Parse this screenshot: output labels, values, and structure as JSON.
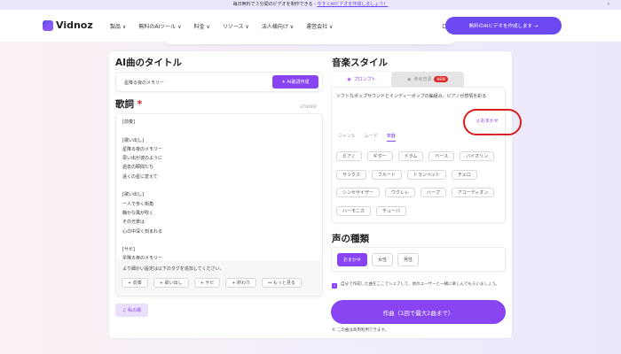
{
  "banner": {
    "text": "毎日無料で３分間のビデオを制作できる - ",
    "link": "今すぐAIビデオを作成しましょう！",
    "close": "×"
  },
  "nav": {
    "brand": "Vidnoz",
    "menu": [
      "製品 ∨",
      "無料のAIツール ∨",
      "料金 ∨",
      "リソース ∨",
      "法人様向け ∨",
      "運営会社 ∨"
    ],
    "login": "ログイン",
    "cta": "無料のAIビデオを作成します →"
  },
  "left": {
    "title_heading": "AI曲のタイトル",
    "title_value": "星降る夜のメモリー",
    "ai_lyrics_button": "✦ AI歌詞作成",
    "lyrics_heading": "歌詞",
    "required": "*",
    "counter": "37/2000",
    "lyrics": "[前奏]\n\n[歌い出し]\n星降る夜のメモリー\n思い出が波のように\n過去の瞬間たち\n遠くの星に変えて\n\n[歌い出し]\n一人で歩く街角\n静かな風が吹く\nその光景は\n心の中深く刻まれる\n\n[サビ]\n星降る夜のメモリー",
    "tag_hint": "より細かい設定は以下のタグを追加してください。",
    "tags": [
      "+ 前奏",
      "+ 歌い出し",
      "+ サビ",
      "+ 終わり",
      "↔ もっと見る"
    ],
    "my_songs": "私の歌"
  },
  "right": {
    "style_heading": "音楽スタイル",
    "tabs": [
      "プロンプト",
      "参考音源"
    ],
    "new_badge": "NEW",
    "prompt_text": "ソフトなポップサウンドとインディーポップの編組み、ピアノが感情を彩る",
    "random_button": "おまかせ",
    "categories": [
      "ジャンル",
      "ムード",
      "楽器"
    ],
    "instruments": [
      "ピアノ",
      "ギター",
      "ドラム",
      "ベース",
      "バイオリン",
      "サックス",
      "フルート",
      "トランペット",
      "チェロ",
      "シンセサイザー",
      "ウクレレ",
      "ハープ",
      "アコーディオン",
      "ハーモニカ",
      "チューバ"
    ],
    "voice_heading": "声の種類",
    "voices": [
      "おまかせ",
      "女性",
      "男性"
    ],
    "share_text": "自分で作成した曲をここでシェアして、他のユーザーと一緒に楽しんでもらいましょう。",
    "share_checked": true,
    "generate_button": "作曲（1回で最大2曲まで）",
    "note": "この曲は商用利用できます。"
  },
  "colors": {
    "accent": "#8844f0",
    "highlight": "#d81e1e"
  }
}
